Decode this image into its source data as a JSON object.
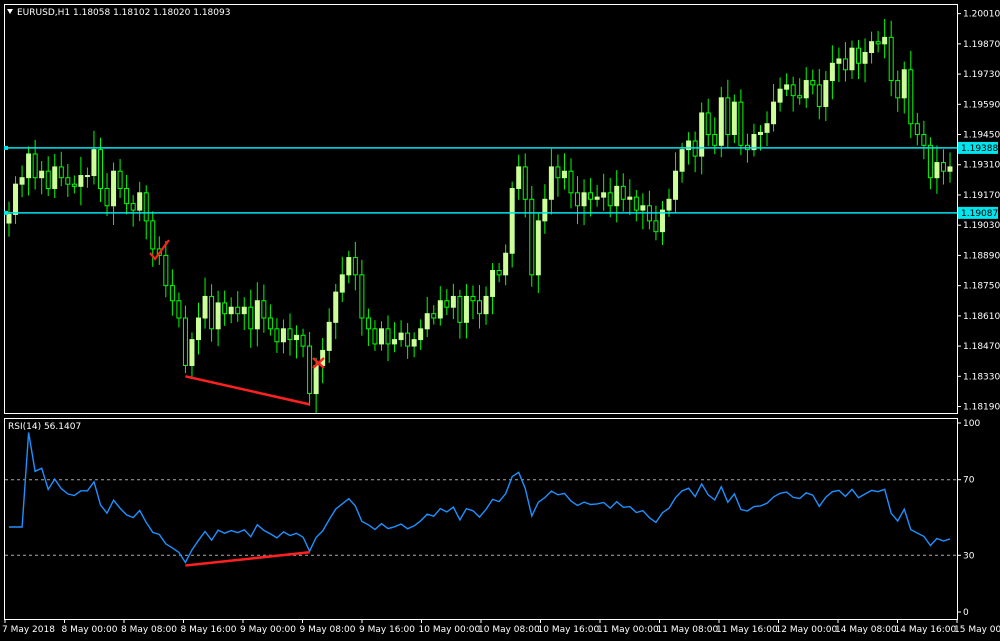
{
  "chart_data": [
    {
      "type": "candlestick",
      "symbol_label": "EURUSD,H1",
      "ohlc_label": "1.18058 1.18102 1.18020 1.18093",
      "ylim": [
        1.1816,
        1.2005
      ],
      "y_ticks": [
        "1.20010",
        "1.19870",
        "1.19730",
        "1.19590",
        "1.19450",
        "1.19310",
        "1.19170",
        "1.19030",
        "1.18890",
        "1.18750",
        "1.18610",
        "1.18470",
        "1.18330",
        "1.18190"
      ],
      "x_ticks": [
        "7 May 2018",
        "8 May 00:00",
        "8 May 08:00",
        "8 May 16:00",
        "9 May 00:00",
        "9 May 08:00",
        "9 May 16:00",
        "10 May 00:00",
        "10 May 08:00",
        "10 May 16:00",
        "11 May 00:00",
        "11 May 08:00",
        "11 May 16:00",
        "12 May 00:00",
        "14 May 08:00",
        "14 May 16:00",
        "15 May 00:00"
      ],
      "levels": [
        {
          "value": 1.19388,
          "label": "1.19388",
          "color": "#00e5ee"
        },
        {
          "value": 1.19087,
          "label": "1.19087",
          "color": "#00e5ee"
        }
      ],
      "candle_up_color": "#ccff99",
      "candle_down_color": "#000000",
      "wick_color": "#00ff00",
      "divergence_color": "#ff2020",
      "closes": [
        1.1908,
        1.1922,
        1.1925,
        1.1936,
        1.1925,
        1.1928,
        1.192,
        1.193,
        1.1925,
        1.1922,
        1.1921,
        1.1926,
        1.1926,
        1.1938,
        1.192,
        1.1912,
        1.1928,
        1.192,
        1.1913,
        1.191,
        1.1918,
        1.1905,
        1.1892,
        1.1889,
        1.1875,
        1.1868,
        1.186,
        1.1838,
        1.185,
        1.186,
        1.187,
        1.1855,
        1.1867,
        1.1862,
        1.1865,
        1.1862,
        1.1865,
        1.1855,
        1.1868,
        1.186,
        1.1855,
        1.1849,
        1.1855,
        1.185,
        1.1852,
        1.1847,
        1.1825,
        1.1838,
        1.1845,
        1.1858,
        1.1872,
        1.188,
        1.1888,
        1.188,
        1.186,
        1.1855,
        1.1848,
        1.1855,
        1.1848,
        1.185,
        1.1853,
        1.1847,
        1.185,
        1.1855,
        1.1862,
        1.186,
        1.1868,
        1.1865,
        1.187,
        1.1858,
        1.187,
        1.1868,
        1.1862,
        1.187,
        1.1882,
        1.188,
        1.189,
        1.192,
        1.193,
        1.1915,
        1.188,
        1.1905,
        1.1915,
        1.193,
        1.1925,
        1.1928,
        1.1918,
        1.1912,
        1.1918,
        1.1915,
        1.1916,
        1.1918,
        1.1912,
        1.1921,
        1.1915,
        1.1916,
        1.191,
        1.1912,
        1.1905,
        1.19,
        1.191,
        1.1915,
        1.1928,
        1.1938,
        1.1942,
        1.1935,
        1.1955,
        1.1945,
        1.194,
        1.1962,
        1.1945,
        1.196,
        1.194,
        1.1938,
        1.1945,
        1.1946,
        1.195,
        1.196,
        1.1966,
        1.1968,
        1.1963,
        1.1962,
        1.197,
        1.1968,
        1.1958,
        1.197,
        1.1978,
        1.198,
        1.1975,
        1.1985,
        1.1978,
        1.1983,
        1.1988,
        1.1987,
        1.199,
        1.197,
        1.1962,
        1.1975,
        1.195,
        1.1945,
        1.194,
        1.1925,
        1.1932,
        1.1928,
        1.193
      ],
      "rsi": {
        "label": "RSI(14) 56.1407",
        "period": 14,
        "ylim": [
          0,
          100
        ],
        "y_ticks": [
          "100",
          "70",
          "30",
          "0"
        ],
        "levels": [
          70,
          30
        ],
        "color": "#1e90ff"
      }
    }
  ]
}
